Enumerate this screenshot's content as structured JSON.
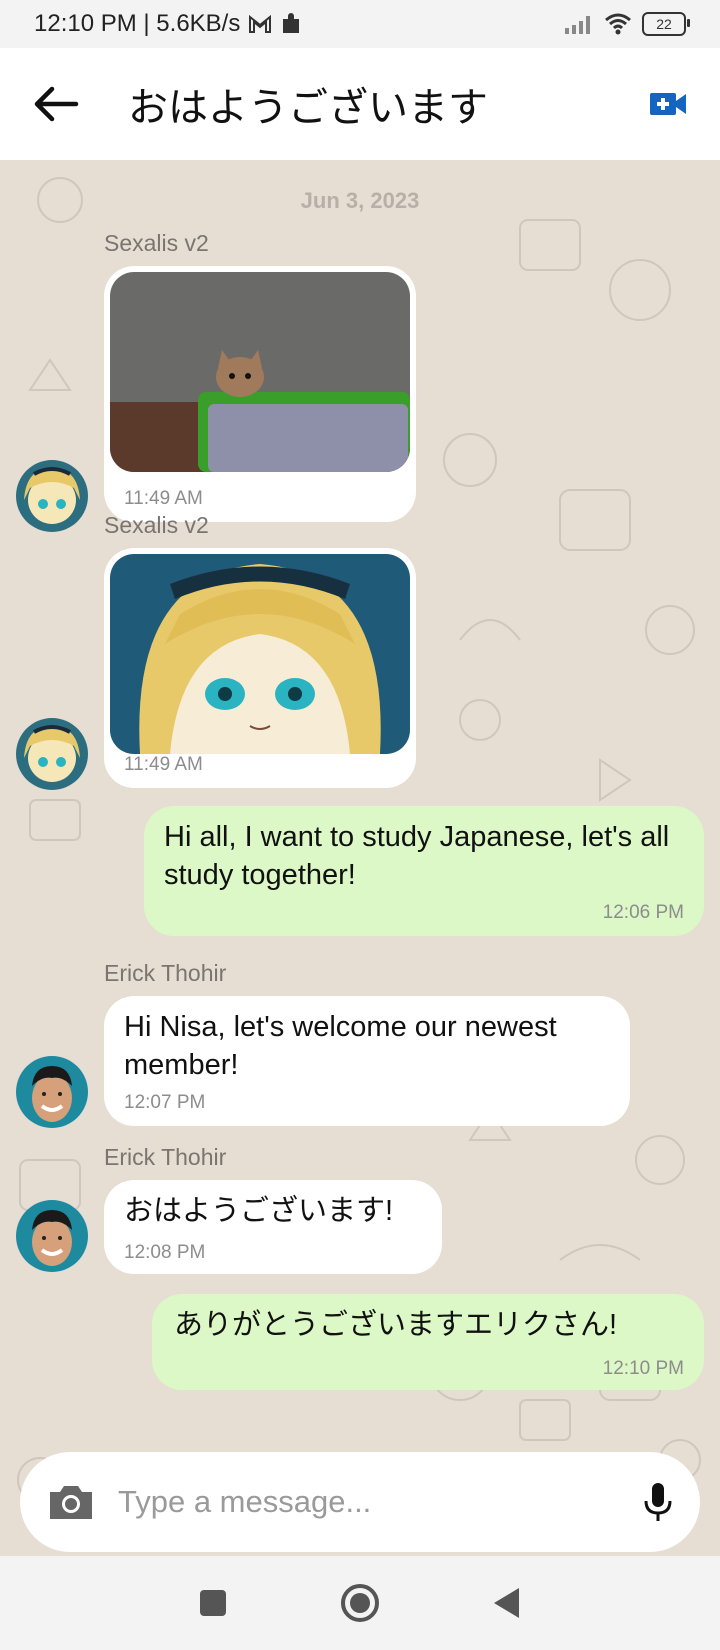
{
  "status_bar": {
    "time": "12:10 PM | 5.6KB/s",
    "battery": "22"
  },
  "app_bar": {
    "title": "おはようございます"
  },
  "chat": {
    "date_separator": "Jun 3, 2023",
    "messages": [
      {
        "sender": "Sexalis v2",
        "time": "11:49 AM"
      },
      {
        "sender": "Sexalis v2",
        "time": "11:49 AM"
      },
      {
        "text": "Hi all, I want to study Japanese, let's all study together!",
        "time": "12:06 PM"
      },
      {
        "sender": "Erick Thohir",
        "text": "Hi Nisa, let's welcome our newest member!",
        "time": "12:07 PM"
      },
      {
        "sender": "Erick Thohir",
        "text": "おはようございます!",
        "time": "12:08 PM"
      },
      {
        "text": "ありがとうございますエリクさん!",
        "time": "12:10 PM"
      }
    ]
  },
  "composer": {
    "placeholder": "Type a message..."
  },
  "colors": {
    "outgoing_bubble": "#dcf8c6",
    "incoming_bubble": "#ffffff",
    "chat_background": "#e6ddd3",
    "video_call_icon": "#1565c0"
  },
  "icons": [
    "back-arrow-icon",
    "video-call-icon",
    "camera-icon",
    "microphone-icon",
    "nav-square-icon",
    "nav-circle-icon",
    "nav-back-triangle-icon",
    "gmail-icon",
    "puzzle-icon",
    "signal-icon",
    "wifi-icon"
  ]
}
